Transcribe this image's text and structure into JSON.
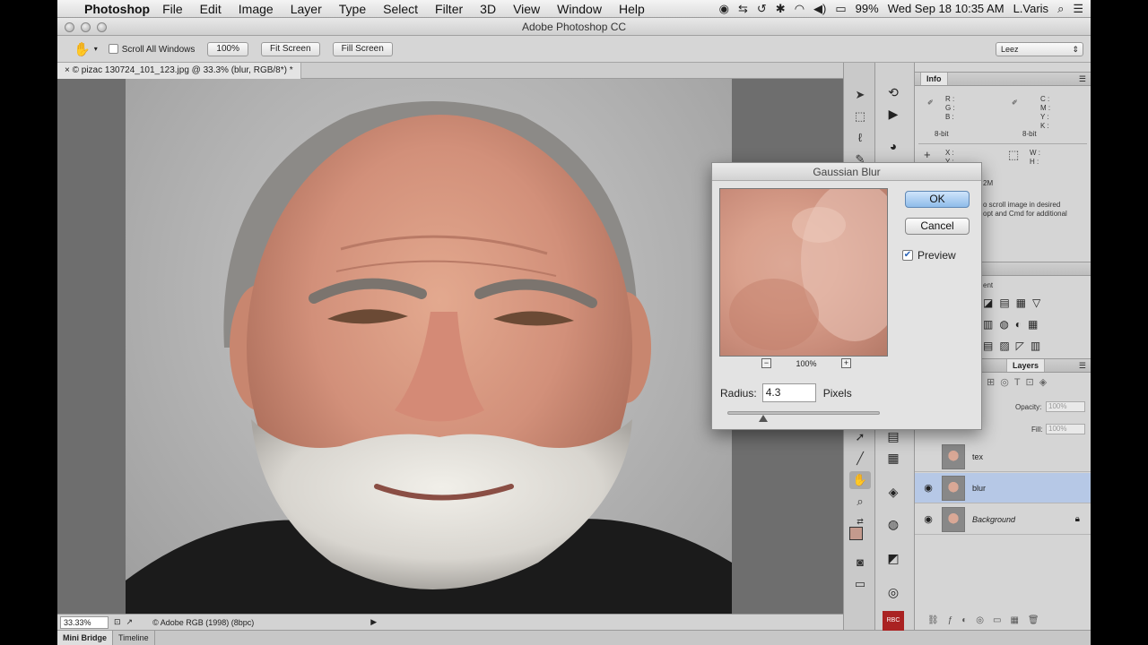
{
  "menubar": {
    "app_name": "Photoshop",
    "items": [
      "File",
      "Edit",
      "Image",
      "Layer",
      "Type",
      "Select",
      "Filter",
      "3D",
      "View",
      "Window",
      "Help"
    ],
    "battery": "99%",
    "datetime": "Wed Sep 18  10:35 AM",
    "user": "L.Varis"
  },
  "window": {
    "title": "Adobe Photoshop CC"
  },
  "options_bar": {
    "scroll_all_windows": "Scroll All Windows",
    "btn_100": "100%",
    "btn_fit": "Fit Screen",
    "btn_fill": "Fill Screen",
    "workspace": "Leez"
  },
  "document": {
    "tab_label": "© pizac 130724_101_123.jpg @ 33.3% (blur, RGB/8*) *",
    "zoom": "33.33%",
    "profile": "© Adobe RGB (1998) (8bpc)"
  },
  "bottom_tabs": [
    "Mini Bridge",
    "Timeline"
  ],
  "info_panel": {
    "tab": "Info",
    "rgb": [
      "R :",
      "G :",
      "B :"
    ],
    "cmyk": [
      "C :",
      "M :",
      "Y :",
      "K :"
    ],
    "bit_left": "8-bit",
    "bit_right": "8-bit",
    "xy": [
      "X :",
      "Y :"
    ],
    "wh": [
      "W :",
      "H :"
    ],
    "doc_size_fragment": "2M",
    "hint_line1": "o scroll image in desired",
    "hint_line2": "opt and Cmd for additional"
  },
  "adjustments_panel": {
    "label": "ent"
  },
  "layers_panel": {
    "tab": "Layers",
    "opacity_label": "Opacity:",
    "opacity_value": "100%",
    "fill_label": "Fill:",
    "fill_value": "100%",
    "layers": [
      {
        "name": "tex",
        "visible": false,
        "selected": false
      },
      {
        "name": "blur",
        "visible": true,
        "selected": true
      },
      {
        "name": "Background",
        "visible": true,
        "selected": false,
        "locked": true
      }
    ]
  },
  "dialog": {
    "title": "Gaussian Blur",
    "ok": "OK",
    "cancel": "Cancel",
    "preview_label": "Preview",
    "preview_checked": true,
    "zoom": "100%",
    "radius_label": "Radius:",
    "radius_value": "4.3",
    "units": "Pixels"
  }
}
